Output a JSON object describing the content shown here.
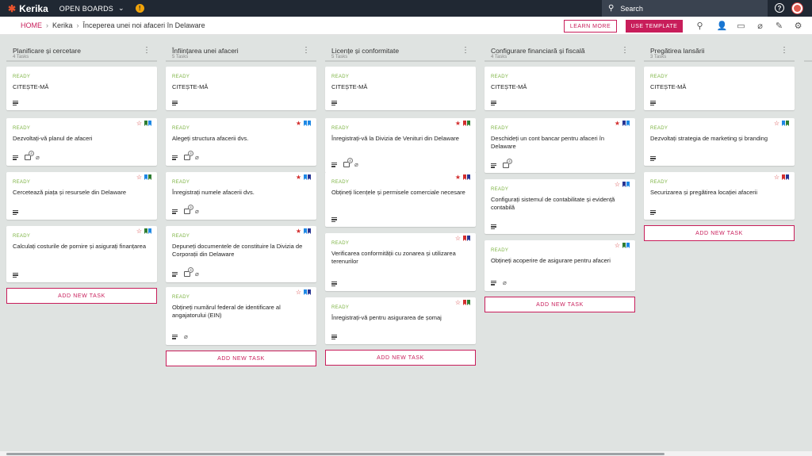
{
  "app": {
    "logo": "Kerika",
    "boards_menu": "OPEN BOARDS",
    "search_placeholder": "Search",
    "help": "?"
  },
  "breadcrumb": {
    "home": "HOME",
    "project": "Kerika",
    "board": "Începerea unei noi afaceri în Delaware"
  },
  "toolbar": {
    "learn_more": "LEARN MORE",
    "use_template": "USE TEMPLATE"
  },
  "icons": [
    "search-icon",
    "add-person-icon",
    "chat-icon",
    "attachment-icon",
    "tools-icon",
    "settings-icon"
  ],
  "colors": {
    "accent": "#c81d5a",
    "ready": "#7cb342",
    "flag_blue": "#1e88e5",
    "flag_navy": "#283593",
    "flag_green": "#2e7d32",
    "flag_red": "#d32f2f"
  },
  "add_task_label": "ADD NEW TASK",
  "columns": [
    {
      "title": "Planificare și cercetare",
      "count": "4 Tasks",
      "cards": [
        {
          "status": "READY",
          "title": "CITEȘTE-MĂ",
          "desc": true
        },
        {
          "status": "READY",
          "title": "Dezvoltați-vă planul de afaceri",
          "desc": true,
          "checklist": "4",
          "attach": true,
          "star": "outline",
          "flags": [
            "green",
            "blue"
          ]
        },
        {
          "status": "READY",
          "title": "Cercetează piața și resursele din Delaware",
          "desc": true,
          "star": "outline",
          "flags": [
            "blue",
            "green"
          ]
        },
        {
          "status": "READY",
          "title": "Calculați costurile de pornire și asigurați finanțarea",
          "desc": true,
          "star": "outline",
          "flags": [
            "green",
            "blue"
          ]
        }
      ]
    },
    {
      "title": "Înființarea unei afaceri",
      "count": "5 Tasks",
      "cards": [
        {
          "status": "READY",
          "title": "CITEȘTE-MĂ",
          "desc": true
        },
        {
          "status": "READY",
          "title": "Alegeți structura afacerii dvs.",
          "desc": true,
          "checklist": "4",
          "attach": true,
          "star": "filled",
          "flags": [
            "blue",
            "blue"
          ]
        },
        {
          "status": "READY",
          "title": "Înregistrați numele afacerii dvs.",
          "desc": true,
          "checklist": "4",
          "attach": true,
          "star": "filled",
          "flags": [
            "blue",
            "navy"
          ]
        },
        {
          "status": "READY",
          "title": "Depuneți documentele de constituire la Divizia de Corporații din Delaware",
          "desc": true,
          "checklist": "4",
          "attach": true,
          "star": "filled",
          "flags": [
            "blue",
            "navy"
          ]
        },
        {
          "status": "READY",
          "title": "Obțineți numărul federal de identificare al angajatorului (EIN)",
          "desc": true,
          "attach": true,
          "star": "outline",
          "flags": [
            "blue",
            "navy"
          ]
        }
      ]
    },
    {
      "title": "Licențe și conformitate",
      "count": "5 Tasks",
      "cards": [
        {
          "status": "READY",
          "title": "CITEȘTE-MĂ",
          "desc": true
        },
        {
          "status": "READY",
          "title": "Înregistrați-vă la Divizia de Venituri din Delaware",
          "desc": true,
          "checklist": "4",
          "attach": true,
          "star": "filled",
          "flags": [
            "red",
            "green"
          ]
        },
        {
          "status": "READY",
          "title": "Obțineți licențele și permisele comerciale necesare",
          "desc": true,
          "star": "filled",
          "flags": [
            "red",
            "navy"
          ]
        },
        {
          "status": "READY",
          "title": "Verificarea conformității cu zonarea și utilizarea terenurilor",
          "desc": true,
          "star": "outline",
          "flags": [
            "red",
            "navy"
          ]
        },
        {
          "status": "READY",
          "title": "Înregistrați-vă pentru asigurarea de șomaj",
          "desc": true,
          "star": "outline",
          "flags": [
            "red",
            "green"
          ]
        }
      ]
    },
    {
      "title": "Configurare financiară și fiscală",
      "count": "4 Tasks",
      "cards": [
        {
          "status": "READY",
          "title": "CITEȘTE-MĂ",
          "desc": true
        },
        {
          "status": "READY",
          "title": "Deschideți un cont bancar pentru afaceri în Delaware",
          "desc": true,
          "checklist": "4",
          "star": "filled",
          "flags": [
            "navy",
            "blue"
          ]
        },
        {
          "status": "READY",
          "title": "Configurați sistemul de contabilitate și evidență contabilă",
          "desc": true,
          "star": "outline",
          "flags": [
            "navy",
            "blue"
          ]
        },
        {
          "status": "READY",
          "title": "Obțineți acoperire de asigurare pentru afaceri",
          "desc": true,
          "attach": true,
          "star": "outline",
          "flags": [
            "green",
            "blue"
          ]
        }
      ]
    },
    {
      "title": "Pregătirea lansării",
      "count": "3 Tasks",
      "cards": [
        {
          "status": "READY",
          "title": "CITEȘTE-MĂ",
          "desc": true
        },
        {
          "status": "READY",
          "title": "Dezvoltați strategia de marketing și branding",
          "desc": true,
          "star": "outline",
          "flags": [
            "blue",
            "green"
          ]
        },
        {
          "status": "READY",
          "title": "Securizarea și pregătirea locației afacerii",
          "desc": true,
          "star": "outline",
          "flags": [
            "red",
            "navy"
          ]
        }
      ]
    }
  ]
}
